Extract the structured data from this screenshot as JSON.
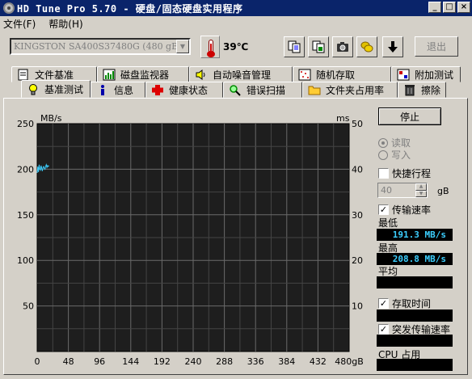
{
  "window": {
    "title": "HD Tune Pro 5.70 - 硬盘/固态硬盘实用程序"
  },
  "menu": {
    "file": "文件(F)",
    "help": "帮助(H)"
  },
  "toolbar": {
    "drive": "KINGSTON SA400S37480G (480 gB)",
    "temperature": "39℃",
    "exit_label": "退出",
    "icons": [
      "copy-icon",
      "save-icon",
      "camera-icon",
      "coins-icon",
      "down-arrow-icon"
    ]
  },
  "tabs_top": [
    {
      "label": "文件基准",
      "icon": "file-benchmark-icon"
    },
    {
      "label": "磁盘监视器",
      "icon": "disk-monitor-icon"
    },
    {
      "label": "自动噪音管理",
      "icon": "speaker-icon"
    },
    {
      "label": "随机存取",
      "icon": "random-access-icon"
    },
    {
      "label": "附加测试",
      "icon": "extra-tests-icon"
    }
  ],
  "tabs_bottom": [
    {
      "label": "基准测试",
      "icon": "lightbulb-icon",
      "active": true
    },
    {
      "label": "信息",
      "icon": "info-icon"
    },
    {
      "label": "健康状态",
      "icon": "health-cross-icon"
    },
    {
      "label": "错误扫描",
      "icon": "magnifier-icon"
    },
    {
      "label": "文件夹占用率",
      "icon": "folder-icon"
    },
    {
      "label": "擦除",
      "icon": "trash-icon"
    }
  ],
  "controls": {
    "stop_label": "停止",
    "read_label": "读取",
    "write_label": "写入",
    "short_stroke_label": "快捷行程",
    "short_stroke_value": "40",
    "short_stroke_unit": "gB",
    "transfer_rate_label": "传输速率",
    "min_label": "最低",
    "min_value": "191.3 MB/s",
    "max_label": "最高",
    "max_value": "208.8 MB/s",
    "avg_label": "平均",
    "avg_value": "",
    "access_time_label": "存取时间",
    "access_time_value": "",
    "burst_rate_label": "突发传输速率",
    "burst_rate_value": "",
    "cpu_label": "CPU 占用",
    "cpu_value": "",
    "read_selected": true,
    "short_stroke_checked": false,
    "transfer_rate_checked": true,
    "access_time_checked": true,
    "burst_rate_checked": true
  },
  "chart_data": {
    "type": "line",
    "ylabel_left": "MB/s",
    "ylabel_right": "ms",
    "ylim_left": [
      0,
      250
    ],
    "ylim_right": [
      0,
      50
    ],
    "left_ticks": [
      "250",
      "200",
      "150",
      "100",
      "50"
    ],
    "right_ticks": [
      "50",
      "40",
      "30",
      "20",
      "10"
    ],
    "xlim": [
      0,
      480
    ],
    "x_ticks": [
      "0",
      "48",
      "96",
      "144",
      "192",
      "240",
      "288",
      "336",
      "384",
      "432",
      "480gB"
    ],
    "grid": true,
    "series": [
      {
        "x": [
          0,
          1,
          2,
          3,
          4,
          5,
          6,
          7,
          8,
          9,
          10,
          11,
          12,
          13,
          14,
          15,
          16,
          17,
          18
        ],
        "y": [
          196,
          203,
          197,
          205,
          200,
          199,
          204,
          201,
          198,
          202,
          203,
          201,
          200,
          203,
          205,
          202,
          204,
          203,
          204
        ],
        "color": "#3ccfff"
      }
    ]
  }
}
